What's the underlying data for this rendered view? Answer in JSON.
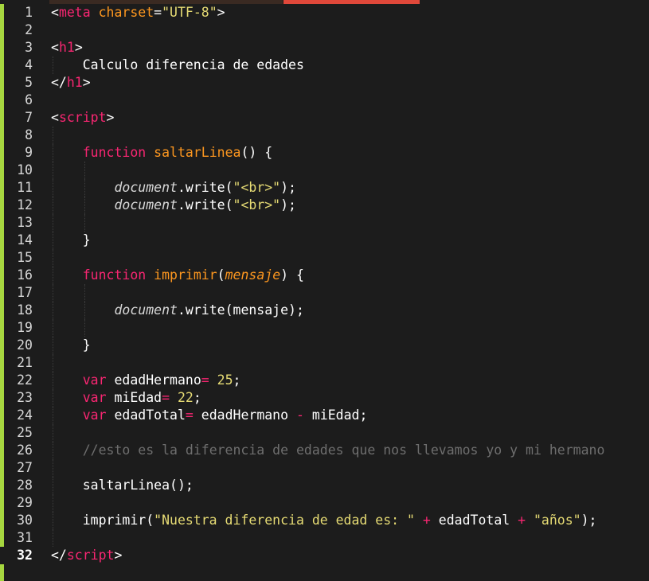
{
  "theme": {
    "background": "#1c1c1c",
    "tag_color": "#f92672",
    "string_color": "#e6db74",
    "function_color": "#fd971f",
    "comment_color": "#6e6e6e",
    "gutter_accent": "#a6d63f",
    "active_tab_color": "#e0483a"
  },
  "editor": {
    "current_line": 32,
    "lines": [
      {
        "n": "1",
        "indent": 0,
        "tokens": [
          {
            "c": "t-plain",
            "t": "<"
          },
          {
            "c": "t-tag",
            "t": "meta"
          },
          {
            "c": "t-plain",
            "t": " "
          },
          {
            "c": "t-attr",
            "t": "charset"
          },
          {
            "c": "t-plain",
            "t": "="
          },
          {
            "c": "t-str",
            "t": "\"UTF-8\""
          },
          {
            "c": "t-plain",
            "t": ">"
          }
        ]
      },
      {
        "n": "2",
        "indent": 0,
        "tokens": []
      },
      {
        "n": "3",
        "indent": 0,
        "tokens": [
          {
            "c": "t-plain",
            "t": "<"
          },
          {
            "c": "t-tag",
            "t": "h1"
          },
          {
            "c": "t-plain",
            "t": ">"
          }
        ]
      },
      {
        "n": "4",
        "indent": 1,
        "tokens": [
          {
            "c": "t-plain",
            "t": "    Calculo diferencia de edades"
          }
        ]
      },
      {
        "n": "5",
        "indent": 0,
        "tokens": [
          {
            "c": "t-plain",
            "t": "</"
          },
          {
            "c": "t-tag",
            "t": "h1"
          },
          {
            "c": "t-plain",
            "t": ">"
          }
        ]
      },
      {
        "n": "6",
        "indent": 0,
        "tokens": []
      },
      {
        "n": "7",
        "indent": 0,
        "tokens": [
          {
            "c": "t-plain",
            "t": "<"
          },
          {
            "c": "t-tag",
            "t": "script"
          },
          {
            "c": "t-plain",
            "t": ">"
          }
        ]
      },
      {
        "n": "8",
        "indent": 1,
        "tokens": []
      },
      {
        "n": "9",
        "indent": 1,
        "tokens": [
          {
            "c": "t-plain",
            "t": "    "
          },
          {
            "c": "t-kw",
            "t": "function"
          },
          {
            "c": "t-plain",
            "t": " "
          },
          {
            "c": "t-fn",
            "t": "saltarLinea"
          },
          {
            "c": "t-plain",
            "t": "() {"
          }
        ]
      },
      {
        "n": "10",
        "indent": 2,
        "tokens": []
      },
      {
        "n": "11",
        "indent": 2,
        "tokens": [
          {
            "c": "t-plain",
            "t": "        "
          },
          {
            "c": "t-obj",
            "t": "document"
          },
          {
            "c": "t-plain",
            "t": ".write("
          },
          {
            "c": "t-str",
            "t": "\"<br>\""
          },
          {
            "c": "t-plain",
            "t": ");"
          }
        ]
      },
      {
        "n": "12",
        "indent": 2,
        "tokens": [
          {
            "c": "t-plain",
            "t": "        "
          },
          {
            "c": "t-obj",
            "t": "document"
          },
          {
            "c": "t-plain",
            "t": ".write("
          },
          {
            "c": "t-str",
            "t": "\"<br>\""
          },
          {
            "c": "t-plain",
            "t": ");"
          }
        ]
      },
      {
        "n": "13",
        "indent": 2,
        "tokens": []
      },
      {
        "n": "14",
        "indent": 1,
        "tokens": [
          {
            "c": "t-plain",
            "t": "    }"
          }
        ]
      },
      {
        "n": "15",
        "indent": 1,
        "tokens": []
      },
      {
        "n": "16",
        "indent": 1,
        "tokens": [
          {
            "c": "t-plain",
            "t": "    "
          },
          {
            "c": "t-kw",
            "t": "function"
          },
          {
            "c": "t-plain",
            "t": " "
          },
          {
            "c": "t-fn",
            "t": "imprimir"
          },
          {
            "c": "t-plain",
            "t": "("
          },
          {
            "c": "t-param",
            "t": "mensaje"
          },
          {
            "c": "t-plain",
            "t": ") {"
          }
        ]
      },
      {
        "n": "17",
        "indent": 2,
        "tokens": []
      },
      {
        "n": "18",
        "indent": 2,
        "tokens": [
          {
            "c": "t-plain",
            "t": "        "
          },
          {
            "c": "t-obj",
            "t": "document"
          },
          {
            "c": "t-plain",
            "t": ".write(mensaje);"
          }
        ]
      },
      {
        "n": "19",
        "indent": 2,
        "tokens": []
      },
      {
        "n": "20",
        "indent": 1,
        "tokens": [
          {
            "c": "t-plain",
            "t": "    }"
          }
        ]
      },
      {
        "n": "21",
        "indent": 1,
        "tokens": []
      },
      {
        "n": "22",
        "indent": 1,
        "tokens": [
          {
            "c": "t-plain",
            "t": "    "
          },
          {
            "c": "t-kw",
            "t": "var"
          },
          {
            "c": "t-plain",
            "t": " edadHermano"
          },
          {
            "c": "t-op",
            "t": "="
          },
          {
            "c": "t-plain",
            "t": " "
          },
          {
            "c": "t-num",
            "t": "25"
          },
          {
            "c": "t-plain",
            "t": ";"
          }
        ]
      },
      {
        "n": "23",
        "indent": 1,
        "tokens": [
          {
            "c": "t-plain",
            "t": "    "
          },
          {
            "c": "t-kw",
            "t": "var"
          },
          {
            "c": "t-plain",
            "t": " miEdad"
          },
          {
            "c": "t-op",
            "t": "="
          },
          {
            "c": "t-plain",
            "t": " "
          },
          {
            "c": "t-num",
            "t": "22"
          },
          {
            "c": "t-plain",
            "t": ";"
          }
        ]
      },
      {
        "n": "24",
        "indent": 1,
        "tokens": [
          {
            "c": "t-plain",
            "t": "    "
          },
          {
            "c": "t-kw",
            "t": "var"
          },
          {
            "c": "t-plain",
            "t": " edadTotal"
          },
          {
            "c": "t-op",
            "t": "="
          },
          {
            "c": "t-plain",
            "t": " edadHermano "
          },
          {
            "c": "t-op",
            "t": "-"
          },
          {
            "c": "t-plain",
            "t": " miEdad;"
          }
        ]
      },
      {
        "n": "25",
        "indent": 1,
        "tokens": []
      },
      {
        "n": "26",
        "indent": 1,
        "tokens": [
          {
            "c": "t-plain",
            "t": "    "
          },
          {
            "c": "t-com",
            "t": "//esto es la diferencia de edades que nos llevamos yo y mi hermano"
          }
        ]
      },
      {
        "n": "27",
        "indent": 1,
        "tokens": []
      },
      {
        "n": "28",
        "indent": 1,
        "tokens": [
          {
            "c": "t-plain",
            "t": "    saltarLinea();"
          }
        ]
      },
      {
        "n": "29",
        "indent": 1,
        "tokens": []
      },
      {
        "n": "30",
        "indent": 1,
        "tokens": [
          {
            "c": "t-plain",
            "t": "    imprimir("
          },
          {
            "c": "t-str",
            "t": "\"Nuestra diferencia de edad es: \""
          },
          {
            "c": "t-plain",
            "t": " "
          },
          {
            "c": "t-op",
            "t": "+"
          },
          {
            "c": "t-plain",
            "t": " edadTotal "
          },
          {
            "c": "t-op",
            "t": "+"
          },
          {
            "c": "t-plain",
            "t": " "
          },
          {
            "c": "t-str",
            "t": "\"años\""
          },
          {
            "c": "t-plain",
            "t": ");"
          }
        ]
      },
      {
        "n": "31",
        "indent": 1,
        "tokens": []
      },
      {
        "n": "32",
        "indent": 0,
        "tokens": [
          {
            "c": "t-plain",
            "t": "</"
          },
          {
            "c": "t-tag",
            "t": "script"
          },
          {
            "c": "t-plain",
            "t": ">"
          }
        ]
      }
    ]
  }
}
